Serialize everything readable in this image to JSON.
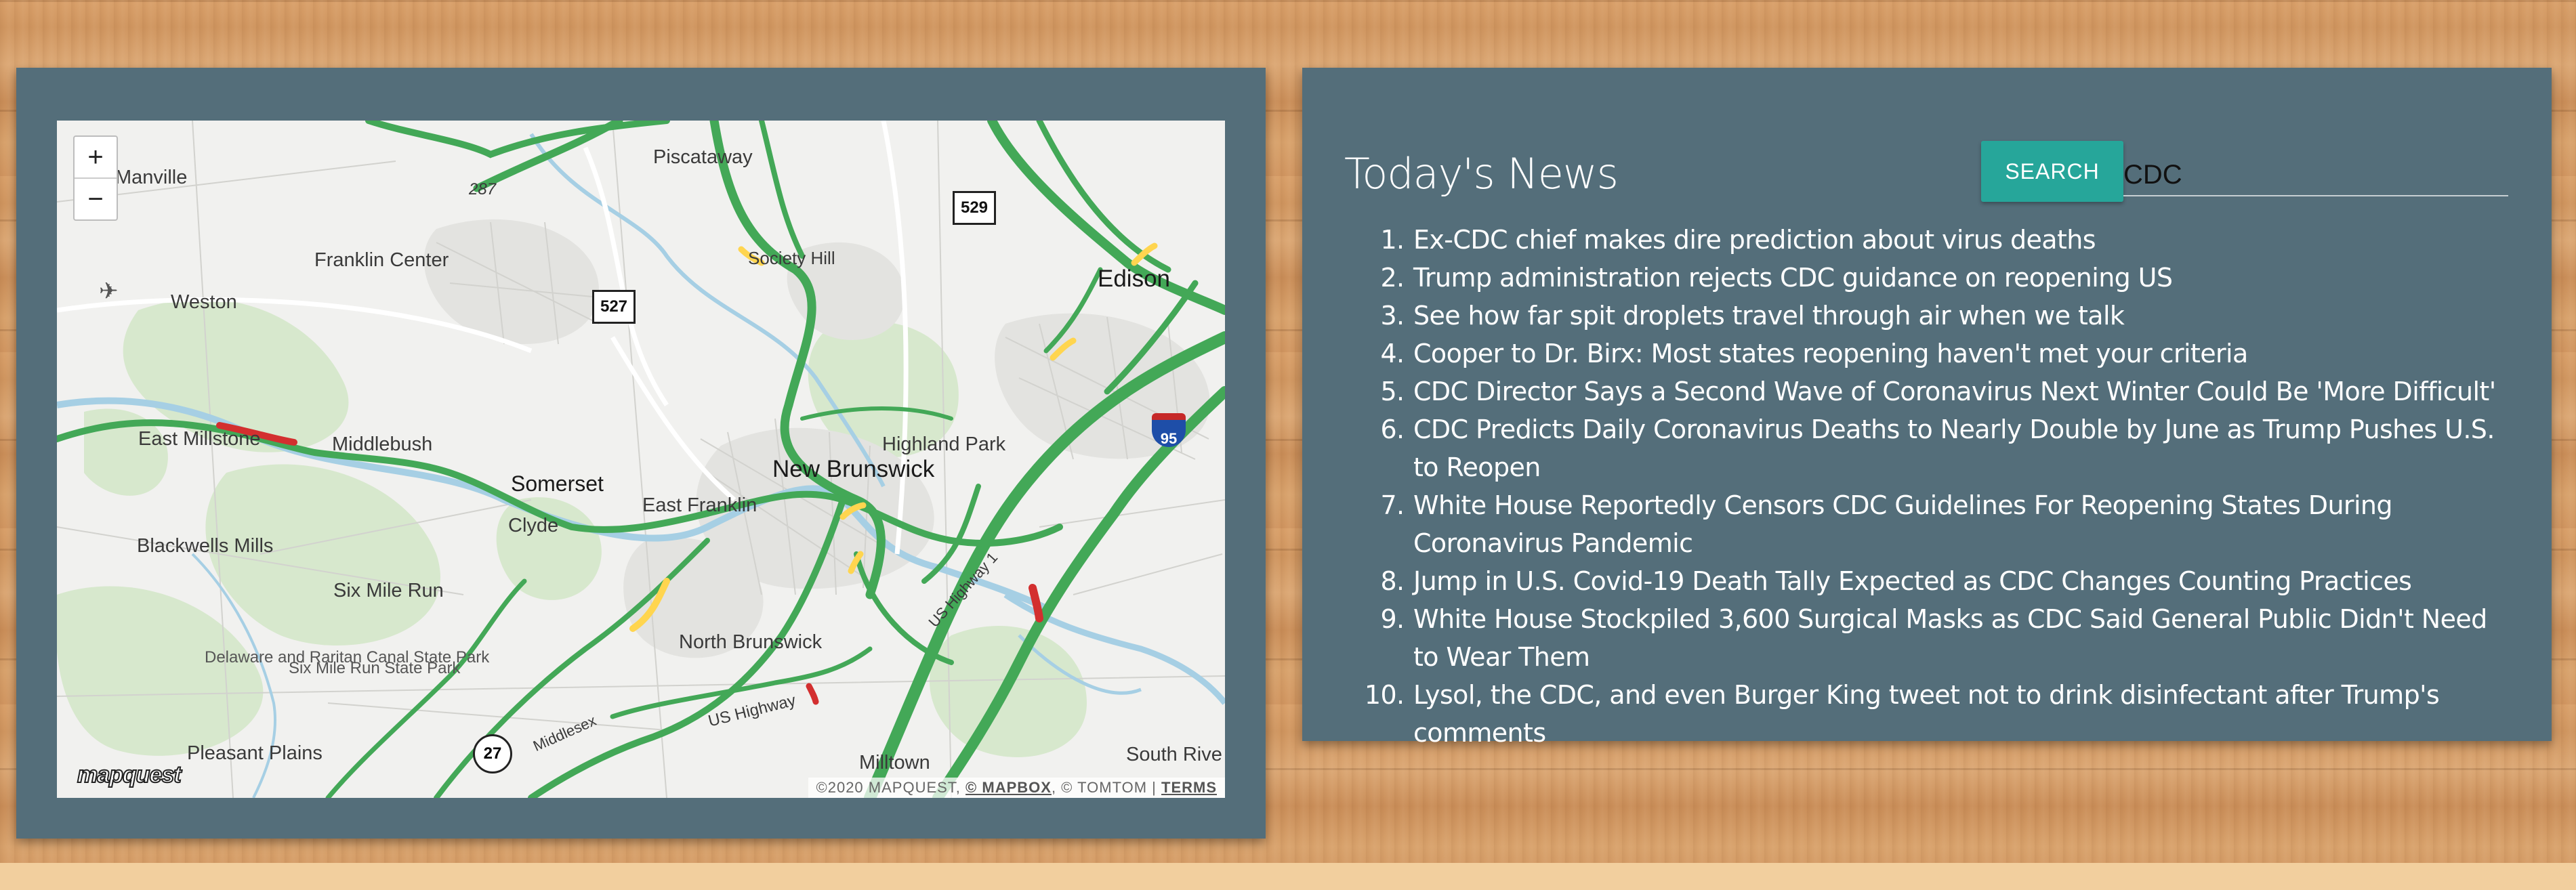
{
  "map": {
    "zoom_in": "+",
    "zoom_out": "−",
    "logo": "mapquest",
    "attribution": {
      "copyright": "©2020 MAPQUEST,",
      "mapbox": "© MAPBOX",
      "tomtom": ", © TOMTOM |",
      "terms": "TERMS"
    },
    "labels": {
      "manville": "Manville",
      "piscataway": "Piscataway",
      "franklin_center": "Franklin Center",
      "society_hill": "Society Hill",
      "weston": "Weston",
      "edison": "Edison",
      "east_millstone": "East Millstone",
      "middlebush": "Middlebush",
      "highland_park": "Highland Park",
      "new_brunswick": "New Brunswick",
      "somerset": "Somerset",
      "east_franklin": "East Franklin",
      "clyde": "Clyde",
      "blackwells_mills": "Blackwells Mills",
      "six_mile_run": "Six Mile Run",
      "delaware_raritan": "Delaware and Raritan Canal State Park",
      "six_mile_run_park": "Six Mile Run State Park",
      "north_brunswick": "North Brunswick",
      "pleasant_plains": "Pleasant Plains",
      "milltown": "Milltown",
      "south_river": "South Rive",
      "road_287": "287",
      "us_highway": "US Highway 1",
      "us_highway_2": "US Highway",
      "middlesex": "Middlesex"
    },
    "shields": {
      "r529": "529",
      "r527": "527",
      "r27": "27",
      "i95": "95"
    }
  },
  "news": {
    "title": "Today's News",
    "search_button": "SEARCH",
    "search_value": "CDC",
    "items": [
      "Ex-CDC chief makes dire prediction about virus deaths",
      "Trump administration rejects CDC guidance on reopening US",
      "See how far spit droplets travel through air when we talk",
      "Cooper to Dr. Birx: Most states reopening haven't met your criteria",
      "CDC Director Says a Second Wave of Coronavirus Next Winter Could Be 'More Difficult'",
      "CDC Predicts Daily Coronavirus Deaths to Nearly Double by June as Trump Pushes U.S. to Reopen",
      "White House Reportedly Censors CDC Guidelines For Reopening States During Coronavirus Pandemic",
      "Jump in U.S. Covid-19 Death Tally Expected as CDC Changes Counting Practices",
      "White House Stockpiled 3,600 Surgical Masks as CDC Said General Public Didn't Need to Wear Them",
      "Lysol, the CDC, and even Burger King tweet not to drink disinfectant after Trump's comments"
    ]
  },
  "colors": {
    "panel": "#546e7a",
    "accent": "#26a69a",
    "traffic_free": "#4caf50",
    "traffic_slow": "#ffd54f",
    "traffic_jam": "#d32f2f",
    "water": "#9fcbe0",
    "park": "#cfe3c4"
  }
}
